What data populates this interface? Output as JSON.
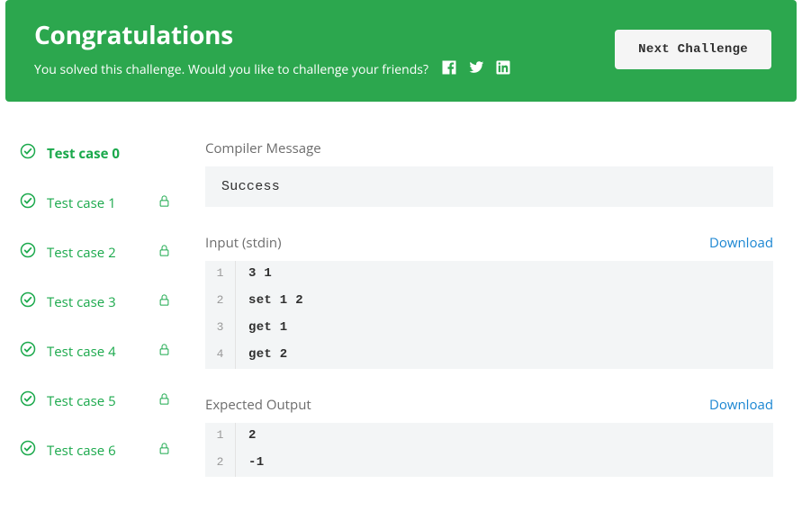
{
  "banner": {
    "title": "Congratulations",
    "subtitle": "You solved this challenge. Would you like to challenge your friends?",
    "next_label": "Next Challenge"
  },
  "test_cases": [
    {
      "label": "Test case 0",
      "locked": false,
      "active": true
    },
    {
      "label": "Test case 1",
      "locked": true,
      "active": false
    },
    {
      "label": "Test case 2",
      "locked": true,
      "active": false
    },
    {
      "label": "Test case 3",
      "locked": true,
      "active": false
    },
    {
      "label": "Test case 4",
      "locked": true,
      "active": false
    },
    {
      "label": "Test case 5",
      "locked": true,
      "active": false
    },
    {
      "label": "Test case 6",
      "locked": true,
      "active": false
    }
  ],
  "compiler": {
    "heading": "Compiler Message",
    "message": "Success"
  },
  "input": {
    "heading": "Input (stdin)",
    "download_label": "Download",
    "lines": [
      "3 1",
      "set 1 2",
      "get 1",
      "get 2"
    ]
  },
  "expected": {
    "heading": "Expected Output",
    "download_label": "Download",
    "lines": [
      "2",
      "-1"
    ]
  }
}
